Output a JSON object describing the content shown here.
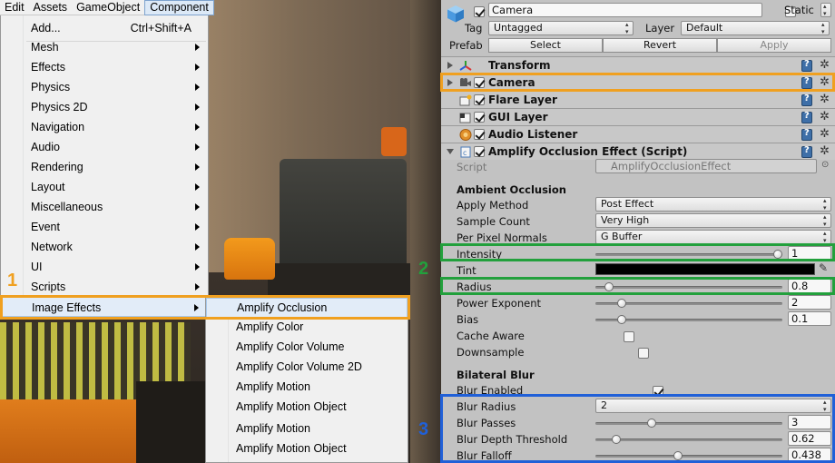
{
  "menubar": {
    "items": [
      "Edit",
      "Assets",
      "GameObject",
      "Component"
    ]
  },
  "component_menu": {
    "items": [
      {
        "label": "Add...",
        "shortcut": "Ctrl+Shift+A"
      },
      {
        "label": "Mesh"
      },
      {
        "label": "Effects"
      },
      {
        "label": "Physics"
      },
      {
        "label": "Physics 2D"
      },
      {
        "label": "Navigation"
      },
      {
        "label": "Audio"
      },
      {
        "label": "Rendering"
      },
      {
        "label": "Layout"
      },
      {
        "label": "Miscellaneous"
      },
      {
        "label": "Event"
      },
      {
        "label": "Network"
      },
      {
        "label": "UI"
      },
      {
        "label": "Scripts"
      },
      {
        "label": "Image Effects"
      }
    ]
  },
  "image_effects_submenu": {
    "items": [
      "Amplify Occlusion",
      "Amplify Color",
      "Amplify Color Volume",
      "Amplify Color Volume 2D",
      "Amplify Motion",
      "Amplify Motion Object",
      "Amplify Motion",
      "Amplify Motion Object"
    ]
  },
  "callouts": {
    "one": "1",
    "two": "2",
    "three": "3"
  },
  "colors": {
    "callout_orange": "#f0a020",
    "callout_green": "#22a03c",
    "callout_blue": "#2060d8",
    "inspector_bg": "#c2c2c2"
  },
  "inspector": {
    "object_name": "Camera",
    "static_label": "Static",
    "tag_label": "Tag",
    "tag_value": "Untagged",
    "layer_label": "Layer",
    "layer_value": "Default",
    "prefab_label": "Prefab",
    "select_label": "Select",
    "revert_label": "Revert",
    "apply_label": "Apply",
    "components": [
      {
        "name": "Transform",
        "icon": "transform-icon"
      },
      {
        "name": "Camera",
        "icon": "camera-icon"
      },
      {
        "name": "Flare Layer",
        "icon": "flare-layer-icon"
      },
      {
        "name": "GUI Layer",
        "icon": "gui-layer-icon"
      },
      {
        "name": "Audio Listener",
        "icon": "audio-listener-icon"
      },
      {
        "name": "Amplify Occlusion Effect (Script)",
        "icon": "script-icon"
      }
    ],
    "script_label": "Script",
    "script_value": "AmplifyOcclusionEffect",
    "ambient_occlusion": {
      "header": "Ambient Occlusion",
      "apply_method_label": "Apply Method",
      "apply_method_value": "Post Effect",
      "sample_count_label": "Sample Count",
      "sample_count_value": "Very High",
      "per_pixel_normals_label": "Per Pixel Normals",
      "per_pixel_normals_value": "G Buffer",
      "intensity_label": "Intensity",
      "intensity_value": "1",
      "tint_label": "Tint",
      "radius_label": "Radius",
      "radius_value": "0.8",
      "power_exponent_label": "Power Exponent",
      "power_exponent_value": "2",
      "bias_label": "Bias",
      "bias_value": "0.1",
      "cache_aware_label": "Cache Aware",
      "downsample_label": "Downsample"
    },
    "bilateral_blur": {
      "header": "Bilateral Blur",
      "blur_enabled_label": "Blur Enabled",
      "blur_radius_label": "Blur Radius",
      "blur_radius_value": "2",
      "blur_passes_label": "Blur Passes",
      "blur_passes_value": "3",
      "blur_depth_threshold_label": "Blur Depth Threshold",
      "blur_depth_threshold_value": "0.62",
      "blur_falloff_label": "Blur Falloff",
      "blur_falloff_value": "0.438"
    },
    "sliders": {
      "intensity": 1.0,
      "radius": 0.05,
      "power_exponent": 0.12,
      "bias": 0.12,
      "blur_passes": 0.29,
      "blur_depth_threshold": 0.09,
      "blur_falloff": 0.44
    }
  }
}
